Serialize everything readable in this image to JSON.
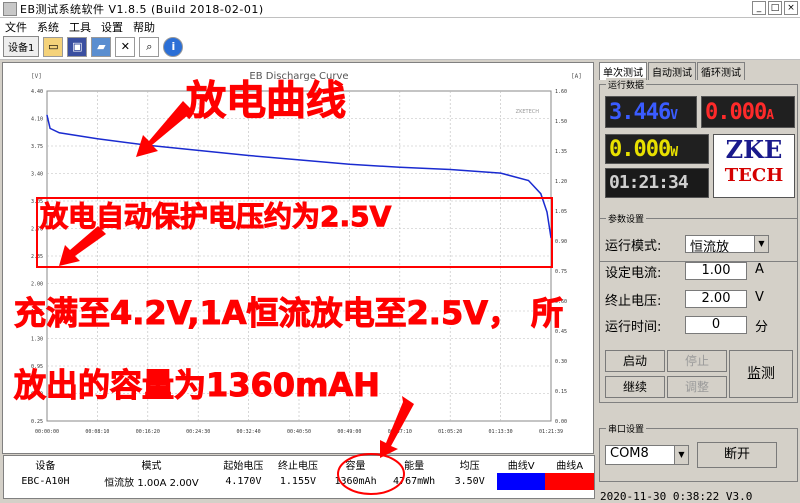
{
  "window": {
    "title": "EB测试系统软件  V1.8.5  (Build 2018-02-01)",
    "controls": [
      "_",
      "□",
      "×"
    ]
  },
  "menu": [
    "文件",
    "系统",
    "工具",
    "设置",
    "帮助"
  ],
  "toolbar": {
    "device_tab": "设备1",
    "icons": [
      "folder-open-icon",
      "save-icon",
      "image-icon",
      "tools-icon",
      "zoom-icon",
      "info-icon"
    ]
  },
  "chart": {
    "title": "EB Discharge Curve",
    "watermark": "ZKETECH",
    "left_unit": "[V]",
    "right_unit": "[A]",
    "left_ticks": [
      "4.40",
      "4.10",
      "3.75",
      "3.40",
      "3.05",
      "2.70",
      "2.35",
      "2.00",
      "1.65",
      "1.30",
      "0.95",
      "0.60",
      "0.25"
    ],
    "right_ticks": [
      "1.60",
      "1.50",
      "1.35",
      "1.20",
      "1.05",
      "0.90",
      "0.75",
      "0.60",
      "0.45",
      "0.30",
      "0.15",
      "0.00"
    ],
    "x_ticks": [
      "00:00:00",
      "00:08:10",
      "00:16:20",
      "00:24:30",
      "00:32:40",
      "00:40:50",
      "00:49:00",
      "00:57:10",
      "01:05:20",
      "01:13:30",
      "01:21:39"
    ],
    "line_color": "#1a2bd0"
  },
  "chart_data": {
    "type": "line",
    "title": "EB Discharge Curve",
    "xlabel": "",
    "ylabel": "[V]",
    "y2label": "[A]",
    "ylim": [
      0.0,
      4.5
    ],
    "y2lim": [
      0.0,
      1.6
    ],
    "xlim_seconds": [
      0,
      4899
    ],
    "series": [
      {
        "x": [
          "00:00:00",
          "00:00:30",
          "00:02:00",
          "00:08:10",
          "00:16:20",
          "00:24:30",
          "00:32:40",
          "00:40:50",
          "00:49:00",
          "00:57:10",
          "01:05:20",
          "01:13:30",
          "01:18:00",
          "01:20:00",
          "01:21:00",
          "01:21:39"
        ],
        "values": [
          4.17,
          3.99,
          3.93,
          3.85,
          3.76,
          3.69,
          3.62,
          3.56,
          3.5,
          3.46,
          3.43,
          3.38,
          3.28,
          3.1,
          2.85,
          2.5
        ]
      }
    ]
  },
  "summary": {
    "headers": [
      "设备",
      "模式",
      "起始电压",
      "终止电压",
      "容量",
      "能量",
      "均压",
      "曲线V",
      "曲线A"
    ],
    "row": {
      "device": "EBC-A10H",
      "mode": "恒流放  1.00A  2.00V",
      "start_v": "4.170V",
      "end_v": "1.155V",
      "capacity": "1360mAh",
      "energy": "4767mWh",
      "avg_v": "3.50V"
    },
    "curve_v_color": "#0000ff",
    "curve_a_color": "#ff0000"
  },
  "right_panel": {
    "tabs": [
      "单次测试",
      "自动测试",
      "循环测试"
    ],
    "run_data_label": "运行数据",
    "voltage": "3.446",
    "voltage_unit": "V",
    "current": "0.000",
    "current_unit": "A",
    "power": "0.000",
    "power_unit": "W",
    "time": "01:21:34",
    "logo_top": "ZKE",
    "logo_bottom": "TECH",
    "params_label": "参数设置",
    "mode_label": "运行模式:",
    "mode_value": "恒流放",
    "current_label": "设定电流:",
    "current_value": "1.00",
    "current_set_unit": "A",
    "cutoff_label": "终止电压:",
    "cutoff_value": "2.00",
    "cutoff_unit": "V",
    "runtime_label": "运行时间:",
    "runtime_value": "0",
    "runtime_unit": "分",
    "buttons": {
      "start": "启动",
      "stop": "停止",
      "continue": "继续",
      "adjust": "调整",
      "monitor": "监测"
    },
    "serial_label": "串口设置",
    "port_value": "COM8",
    "disconnect": "断开",
    "status_text": "2020-11-30 0:38:22  V3.0"
  },
  "annotations": {
    "discharge_curve": "放电曲线",
    "auto_protect": "放电自动保护电压约为2.5V",
    "full_charge": "充满至4.2V,1A恒流放电至2.5V， 所",
    "capacity_note": "放出的容量为1360mAH"
  }
}
